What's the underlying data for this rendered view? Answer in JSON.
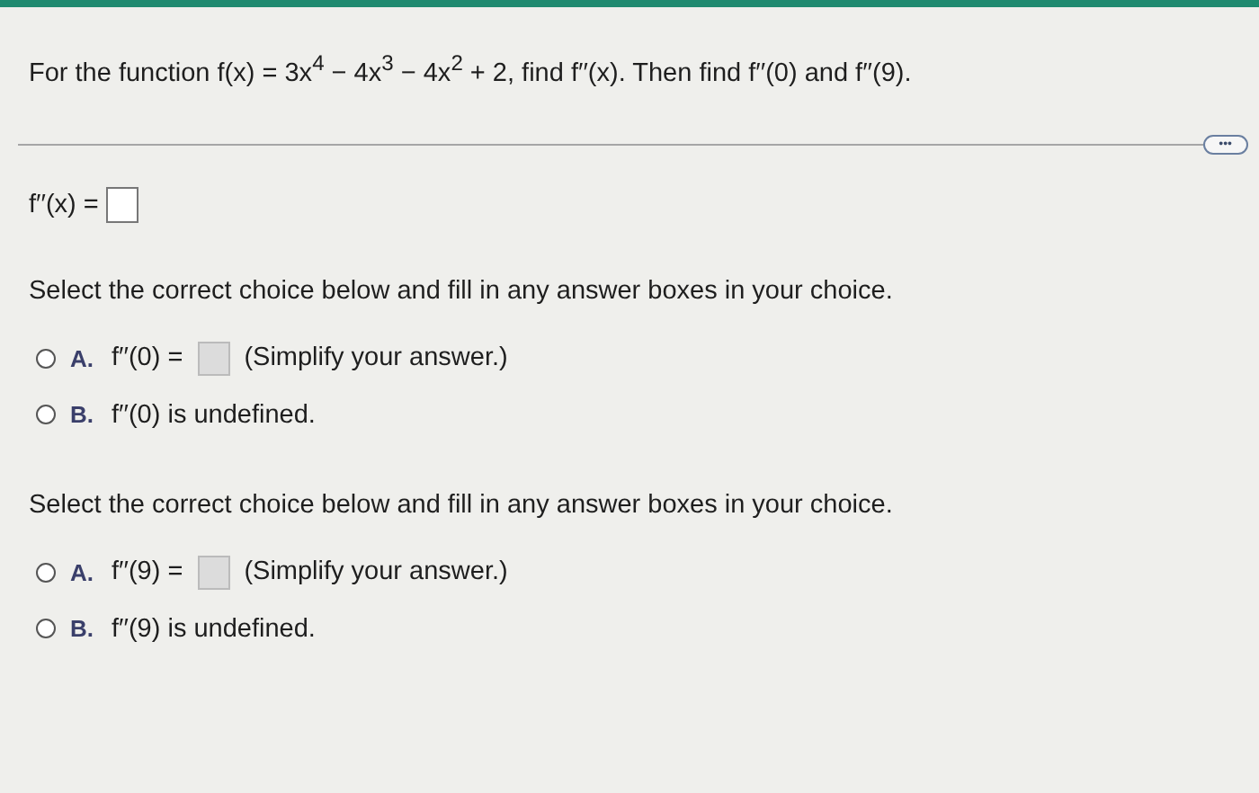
{
  "question": "For the function f(x) = 3x$^{4}$ − 4x$^{3}$ − 4x$^{2}$ + 2, find f′′(x). Then find f′′(0) and f′′(9).",
  "more_button": {
    "label": "•••"
  },
  "answer": {
    "label": "f′′(x) ="
  },
  "parts": [
    {
      "instruction": "Select the correct choice below and fill in any answer boxes in your choice.",
      "choices": [
        {
          "letter": "A.",
          "kind": "input",
          "text": "f′′(0) =",
          "note": "(Simplify your answer.)",
          "selected": false
        },
        {
          "letter": "B.",
          "kind": "text",
          "text": "f′′(0) is undefined.",
          "selected": false
        }
      ]
    },
    {
      "instruction": "Select the correct choice below and fill in any answer boxes in your choice.",
      "choices": [
        {
          "letter": "A.",
          "kind": "input",
          "text": "f′′(9) =",
          "note": "(Simplify your answer.)",
          "selected": false
        },
        {
          "letter": "B.",
          "kind": "text",
          "text": "f′′(9) is undefined.",
          "selected": false
        }
      ]
    }
  ]
}
